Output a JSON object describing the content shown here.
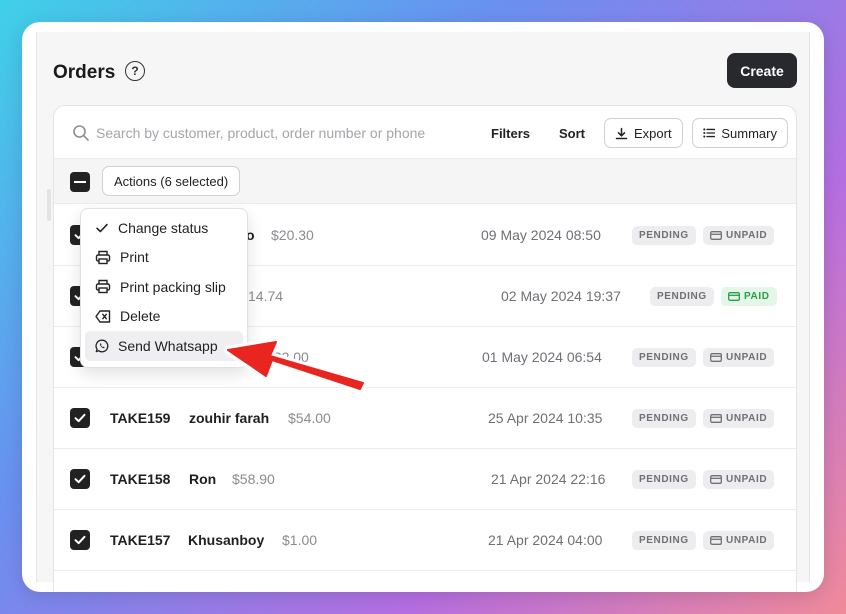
{
  "page": {
    "title": "Orders",
    "create_label": "Create"
  },
  "toolbar": {
    "search_placeholder": "Search by customer, product, order number or phone",
    "filters_label": "Filters",
    "sort_label": "Sort",
    "export_label": "Export",
    "summary_label": "Summary"
  },
  "actions": {
    "label": "Actions (6 selected)"
  },
  "menu": {
    "items": [
      {
        "label": "Change status",
        "icon": "check-icon"
      },
      {
        "label": "Print",
        "icon": "printer-icon"
      },
      {
        "label": "Print packing slip",
        "icon": "printer-icon"
      },
      {
        "label": "Delete",
        "icon": "delete-icon"
      },
      {
        "label": "Send Whatsapp",
        "icon": "whatsapp-icon"
      }
    ]
  },
  "orders": [
    {
      "order_no": "",
      "customer": "o",
      "amount": "$20.30",
      "date": "09 May 2024 08:50",
      "status": "PENDING",
      "payment": "UNPAID"
    },
    {
      "order_no": "",
      "customer": "",
      "amount": "14.74",
      "date": "02 May 2024 19:37",
      "status": "PENDING",
      "payment": "PAID"
    },
    {
      "order_no": "",
      "customer": "",
      "amount": "222.00",
      "date": "01 May 2024 06:54",
      "status": "PENDING",
      "payment": "UNPAID"
    },
    {
      "order_no": "TAKE159",
      "customer": "zouhir farah",
      "amount": "$54.00",
      "date": "25 Apr 2024 10:35",
      "status": "PENDING",
      "payment": "UNPAID"
    },
    {
      "order_no": "TAKE158",
      "customer": "Ron",
      "amount": "$58.90",
      "date": "21 Apr 2024 22:16",
      "status": "PENDING",
      "payment": "UNPAID"
    },
    {
      "order_no": "TAKE157",
      "customer": "Khusanboy",
      "amount": "$1.00",
      "date": "21 Apr 2024 04:00",
      "status": "PENDING",
      "payment": "UNPAID"
    }
  ],
  "colors": {
    "accent": "#27292d",
    "paid": "#2a9d48",
    "arrow": "#e8251f"
  }
}
